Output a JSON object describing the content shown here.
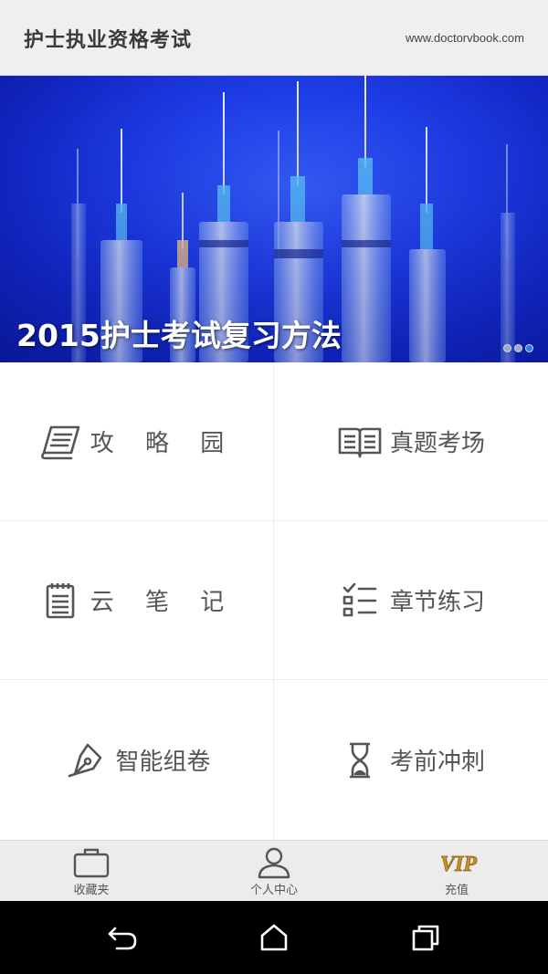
{
  "header": {
    "title": "护士执业资格考试",
    "url": "www.doctorvbook.com"
  },
  "banner": {
    "caption": "2015护士考试复习方法",
    "slide_count": 3,
    "active_slide": 3
  },
  "menu": {
    "items": [
      {
        "label": "攻 略 园",
        "icon": "scroll-icon"
      },
      {
        "label": "真题考场",
        "icon": "book-icon"
      },
      {
        "label": "云 笔 记",
        "icon": "notepad-icon"
      },
      {
        "label": "章节练习",
        "icon": "checklist-icon"
      },
      {
        "label": "智能组卷",
        "icon": "pen-nib-icon"
      },
      {
        "label": "考前冲刺",
        "icon": "hourglass-icon"
      }
    ]
  },
  "tabs": [
    {
      "label": "收藏夹",
      "icon": "briefcase-icon"
    },
    {
      "label": "个人中心",
      "icon": "person-icon"
    },
    {
      "label": "充值",
      "icon": "vip-icon",
      "icon_text": "VIP"
    }
  ],
  "colors": {
    "header_bg": "#efefef",
    "banner_blue": "#1f3ee8",
    "tab_bar_bg": "#ececec",
    "vip_gold": "#c9932a",
    "system_nav_bg": "#000000"
  },
  "system_nav": [
    "back-icon",
    "home-icon",
    "recents-icon"
  ]
}
